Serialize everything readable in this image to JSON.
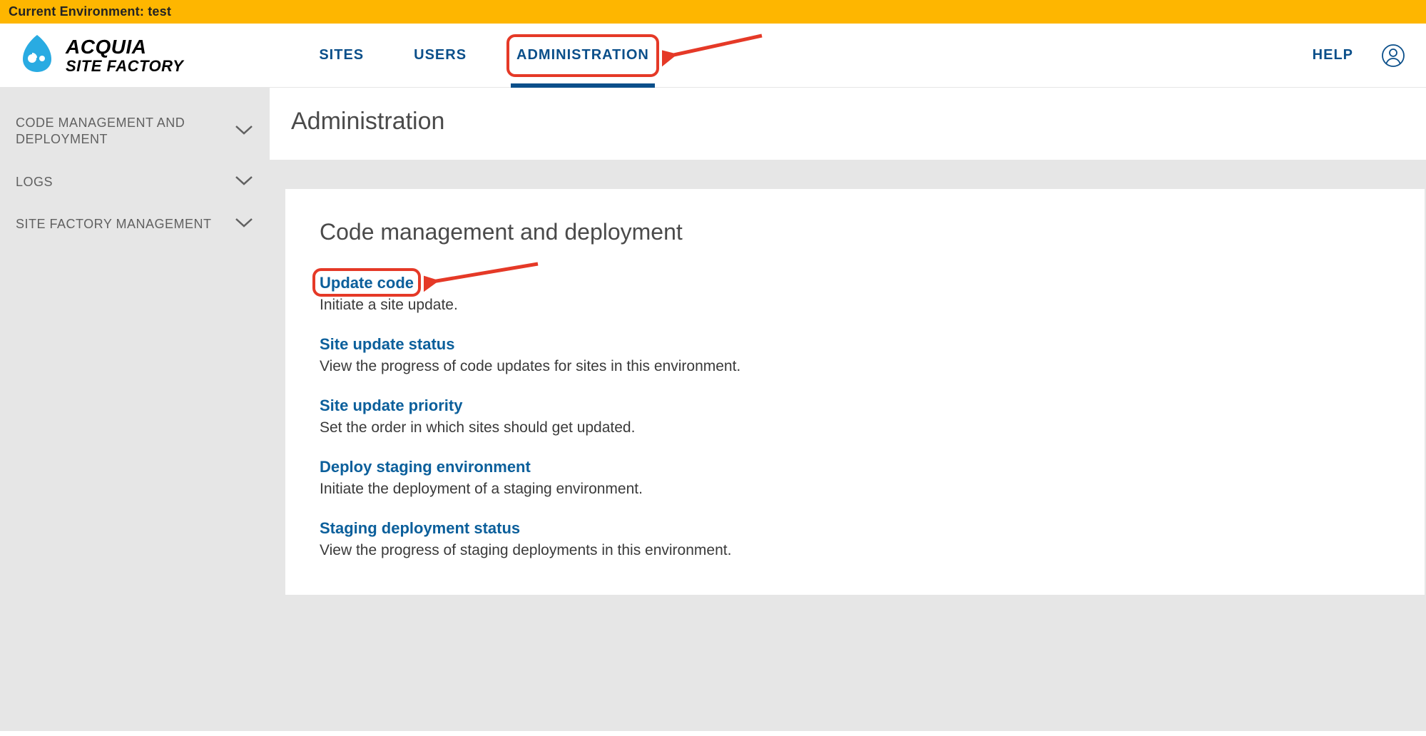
{
  "env_bar": {
    "text": "Current Environment: test"
  },
  "brand": {
    "line1": "ACQUIA",
    "line2": "SITE FACTORY"
  },
  "nav": {
    "tabs": [
      {
        "label": "SITES",
        "active": false
      },
      {
        "label": "USERS",
        "active": false
      },
      {
        "label": "ADMINISTRATION",
        "active": true
      }
    ],
    "help": "HELP"
  },
  "sidebar": {
    "items": [
      {
        "label": "CODE MANAGEMENT AND DEPLOYMENT"
      },
      {
        "label": "LOGS"
      },
      {
        "label": "SITE FACTORY MANAGEMENT"
      }
    ]
  },
  "page": {
    "title": "Administration"
  },
  "section": {
    "title": "Code management and deployment",
    "options": [
      {
        "link": "Update code",
        "desc": "Initiate a site update."
      },
      {
        "link": "Site update status",
        "desc": "View the progress of code updates for sites in this environment."
      },
      {
        "link": "Site update priority",
        "desc": "Set the order in which sites should get updated."
      },
      {
        "link": "Deploy staging environment",
        "desc": "Initiate the deployment of a staging environment."
      },
      {
        "link": "Staging deployment status",
        "desc": "View the progress of staging deployments in this environment."
      }
    ]
  },
  "annotations": {
    "admin_box": true,
    "update_code_box": true
  }
}
